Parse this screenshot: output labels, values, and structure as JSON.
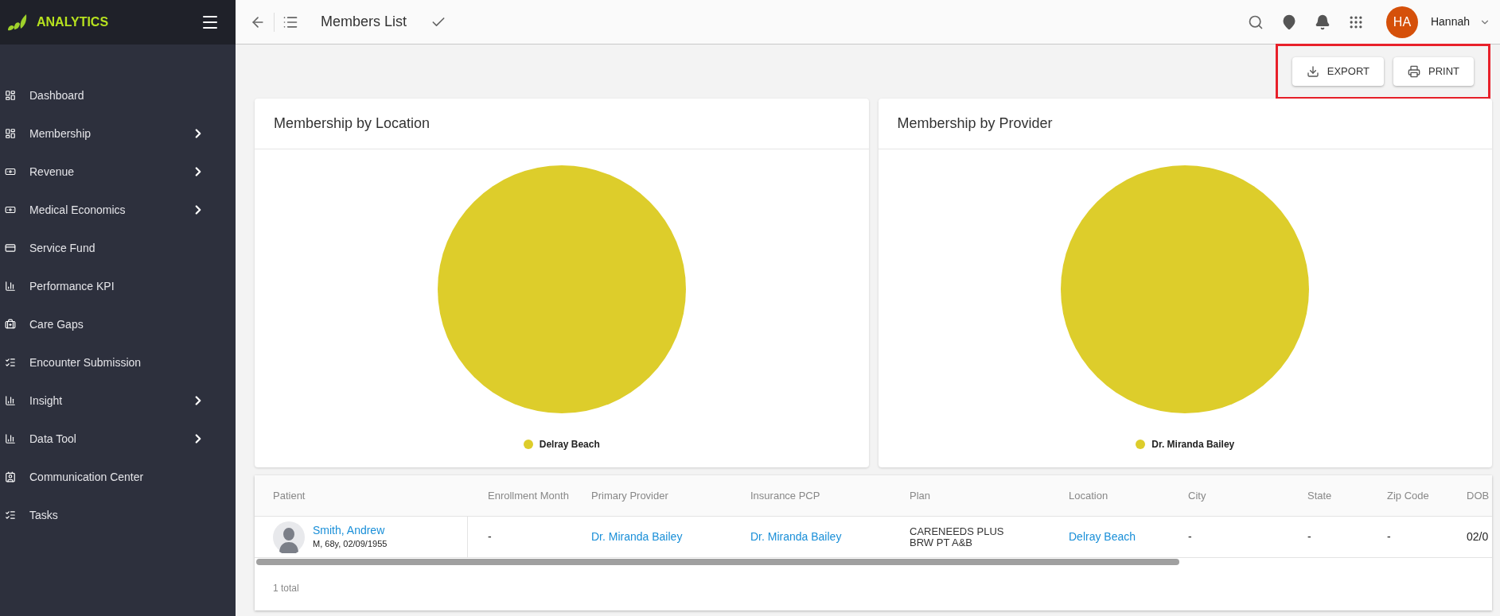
{
  "brand": "ANALYTICS",
  "sidebar": {
    "items": [
      {
        "label": "Dashboard",
        "has_submenu": false
      },
      {
        "label": "Membership",
        "has_submenu": true
      },
      {
        "label": "Revenue",
        "has_submenu": true
      },
      {
        "label": "Medical Economics",
        "has_submenu": true
      },
      {
        "label": "Service Fund",
        "has_submenu": false
      },
      {
        "label": "Performance KPI",
        "has_submenu": false
      },
      {
        "label": "Care Gaps",
        "has_submenu": false
      },
      {
        "label": "Encounter Submission",
        "has_submenu": false
      },
      {
        "label": "Insight",
        "has_submenu": true
      },
      {
        "label": "Data Tool",
        "has_submenu": true
      },
      {
        "label": "Communication Center",
        "has_submenu": false
      },
      {
        "label": "Tasks",
        "has_submenu": false
      }
    ]
  },
  "topbar": {
    "title": "Members List",
    "user": {
      "initials": "HA",
      "name": "Hannah"
    }
  },
  "actions": [
    "EXPORT",
    "PRINT"
  ],
  "charts": [
    {
      "title": "Membership by Location",
      "legend": [
        {
          "label": "Delray Beach",
          "color": "#ddcd2b"
        }
      ]
    },
    {
      "title": "Membership by Provider",
      "legend": [
        {
          "label": "Dr. Miranda Bailey",
          "color": "#ddcd2b"
        }
      ]
    }
  ],
  "table": {
    "columns": [
      "Patient",
      "Enrollment Month",
      "Primary Provider",
      "Insurance PCP",
      "Plan",
      "Location",
      "City",
      "State",
      "Zip Code",
      "DOB"
    ],
    "rows": [
      {
        "cells": [
          {
            "kind": "patient",
            "name": "Smith, Andrew",
            "details": "M, 68y, 02/09/1955"
          },
          {
            "kind": "text",
            "text": "-"
          },
          {
            "kind": "link",
            "text": "Dr. Miranda Bailey"
          },
          {
            "kind": "link",
            "text": "Dr. Miranda Bailey"
          },
          {
            "kind": "multiline",
            "lines": [
              "CARENEEDS PLUS",
              "BRW PT A&B"
            ]
          },
          {
            "kind": "link",
            "text": "Delray Beach"
          },
          {
            "kind": "text",
            "text": "-"
          },
          {
            "kind": "text",
            "text": "-"
          },
          {
            "kind": "text",
            "text": "-"
          },
          {
            "kind": "text",
            "text": "02/0"
          }
        ]
      }
    ],
    "footer": "1 total"
  }
}
